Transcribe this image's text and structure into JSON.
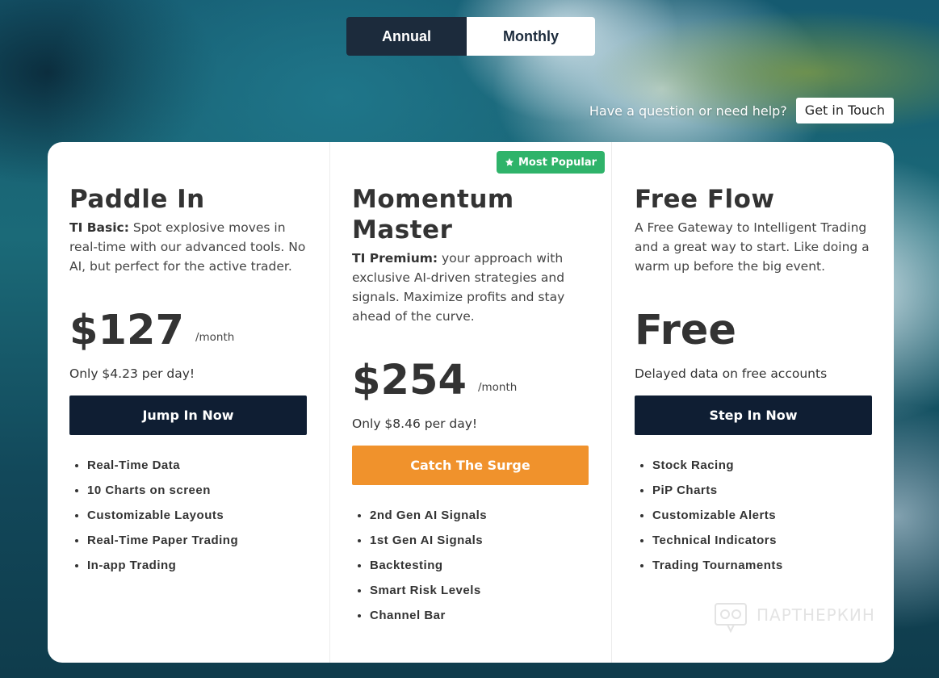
{
  "billing_toggle": {
    "annual_label": "Annual",
    "monthly_label": "Monthly",
    "selected": "Annual"
  },
  "help": {
    "question": "Have a question or need help?",
    "contact_label": "Get in Touch"
  },
  "colors": {
    "dark_navy": "#0f1e33",
    "orange": "#f0922c",
    "badge_green": "#2fb36a"
  },
  "plans": [
    {
      "title": "Paddle In",
      "tier": "TI Basic:",
      "description": " Spot explosive moves in real-time with our advanced tools. No AI, but perfect for the active trader.",
      "price": "$127",
      "per": "/month",
      "per_day": "Only $4.23 per day!",
      "cta": "Jump In Now",
      "features": [
        "Real-Time Data",
        "10 Charts on screen",
        "Customizable Layouts",
        "Real-Time Paper Trading",
        "In-app Trading"
      ]
    },
    {
      "title": "Momentum Master",
      "badge": "Most Popular",
      "badge_icon": "star-icon",
      "tier": "TI Premium:",
      "description": " your approach with exclusive AI-driven strategies and signals. Maximize profits and stay ahead of the curve.",
      "price": "$254",
      "per": "/month",
      "per_day": "Only $8.46 per day!",
      "cta": "Catch The Surge",
      "features": [
        "2nd Gen AI Signals",
        "1st Gen AI Signals",
        "Backtesting",
        "Smart Risk Levels",
        "Channel Bar"
      ]
    },
    {
      "title": "Free Flow",
      "description": "A Free Gateway to Intelligent Trading and a great way to start. Like doing a warm up before the big event.",
      "price": "Free",
      "per_day": "Delayed data on free accounts",
      "cta": "Step In Now",
      "features": [
        "Stock Racing",
        "PiP Charts",
        "Customizable Alerts",
        "Technical Indicators",
        "Trading Tournaments"
      ]
    }
  ],
  "watermark": {
    "text": "ПАРТНЕРКИН",
    "icon": "partnerkin-logo-icon"
  }
}
